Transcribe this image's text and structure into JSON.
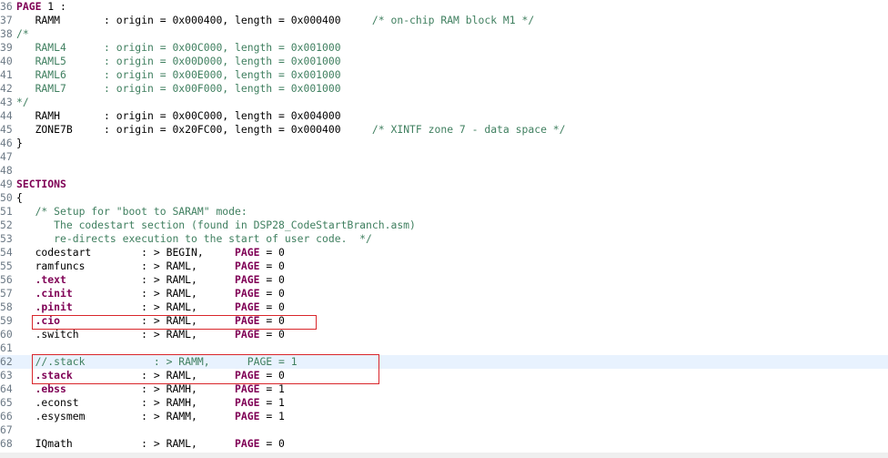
{
  "editor": {
    "lines": [
      {
        "n": "36",
        "tokens": [
          {
            "c": "kw",
            "t": "PAGE"
          },
          {
            "c": "text",
            "t": " 1 :"
          }
        ]
      },
      {
        "n": "37",
        "tokens": [
          {
            "c": "text",
            "t": "   RAMM       : origin = 0x000400, length = 0x000400     "
          },
          {
            "c": "comment",
            "t": "/* on-chip RAM block M1 */"
          }
        ]
      },
      {
        "n": "38",
        "tokens": [
          {
            "c": "comment",
            "t": "/*"
          }
        ]
      },
      {
        "n": "39",
        "tokens": [
          {
            "c": "comment",
            "t": "   RAML4      : origin = 0x00C000, length = 0x001000"
          }
        ]
      },
      {
        "n": "40",
        "tokens": [
          {
            "c": "comment",
            "t": "   RAML5      : origin = 0x00D000, length = 0x001000"
          }
        ]
      },
      {
        "n": "41",
        "tokens": [
          {
            "c": "comment",
            "t": "   RAML6      : origin = 0x00E000, length = 0x001000"
          }
        ]
      },
      {
        "n": "42",
        "tokens": [
          {
            "c": "comment",
            "t": "   RAML7      : origin = 0x00F000, length = 0x001000"
          }
        ]
      },
      {
        "n": "43",
        "tokens": [
          {
            "c": "comment",
            "t": "*/"
          }
        ]
      },
      {
        "n": "44",
        "tokens": [
          {
            "c": "text",
            "t": "   RAMH       : origin = 0x00C000, length = 0x004000"
          }
        ]
      },
      {
        "n": "45",
        "tokens": [
          {
            "c": "text",
            "t": "   ZONE7B     : origin = 0x20FC00, length = 0x000400     "
          },
          {
            "c": "comment",
            "t": "/* XINTF zone 7 - data space */"
          }
        ]
      },
      {
        "n": "46",
        "tokens": [
          {
            "c": "text",
            "t": "}"
          }
        ]
      },
      {
        "n": "47",
        "tokens": []
      },
      {
        "n": "48",
        "tokens": []
      },
      {
        "n": "49",
        "tokens": [
          {
            "c": "kw",
            "t": "SECTIONS"
          }
        ]
      },
      {
        "n": "50",
        "tokens": [
          {
            "c": "text",
            "t": "{"
          }
        ]
      },
      {
        "n": "51",
        "tokens": [
          {
            "c": "comment",
            "t": "   /* Setup for \"boot to SARAM\" mode:"
          }
        ]
      },
      {
        "n": "52",
        "tokens": [
          {
            "c": "comment",
            "t": "      The codestart section (found in DSP28_CodeStartBranch.asm)"
          }
        ]
      },
      {
        "n": "53",
        "tokens": [
          {
            "c": "comment",
            "t": "      re-directs execution to the start of user code.  */"
          }
        ]
      },
      {
        "n": "54",
        "tokens": [
          {
            "c": "text",
            "t": "   codestart        : > BEGIN,     "
          },
          {
            "c": "kw",
            "t": "PAGE"
          },
          {
            "c": "text",
            "t": " = 0"
          }
        ]
      },
      {
        "n": "55",
        "tokens": [
          {
            "c": "text",
            "t": "   ramfuncs         : > RAML,      "
          },
          {
            "c": "kw",
            "t": "PAGE"
          },
          {
            "c": "text",
            "t": " = 0"
          }
        ]
      },
      {
        "n": "56",
        "tokens": [
          {
            "c": "text",
            "t": "   "
          },
          {
            "c": "dir",
            "t": ".text"
          },
          {
            "c": "text",
            "t": "            : > RAML,      "
          },
          {
            "c": "kw",
            "t": "PAGE"
          },
          {
            "c": "text",
            "t": " = 0"
          }
        ]
      },
      {
        "n": "57",
        "tokens": [
          {
            "c": "text",
            "t": "   "
          },
          {
            "c": "dir",
            "t": ".cinit"
          },
          {
            "c": "text",
            "t": "           : > RAML,      "
          },
          {
            "c": "kw",
            "t": "PAGE"
          },
          {
            "c": "text",
            "t": " = 0"
          }
        ]
      },
      {
        "n": "58",
        "tokens": [
          {
            "c": "text",
            "t": "   "
          },
          {
            "c": "dir",
            "t": ".pinit"
          },
          {
            "c": "text",
            "t": "           : > RAML,      "
          },
          {
            "c": "kw",
            "t": "PAGE"
          },
          {
            "c": "text",
            "t": " = 0"
          }
        ]
      },
      {
        "n": "59",
        "tokens": [
          {
            "c": "text",
            "t": "   "
          },
          {
            "c": "dir",
            "t": ".cio"
          },
          {
            "c": "text",
            "t": "             : > RAML,      "
          },
          {
            "c": "kw",
            "t": "PAGE"
          },
          {
            "c": "text",
            "t": " = 0"
          }
        ]
      },
      {
        "n": "60",
        "tokens": [
          {
            "c": "text",
            "t": "   .switch          : > RAML,      "
          },
          {
            "c": "kw",
            "t": "PAGE"
          },
          {
            "c": "text",
            "t": " = 0"
          }
        ]
      },
      {
        "n": "61",
        "tokens": []
      },
      {
        "n": "62",
        "hl": true,
        "tokens": [
          {
            "c": "comment",
            "t": "   //.stack           : > RAMM,      PAGE = 1"
          }
        ]
      },
      {
        "n": "63",
        "tokens": [
          {
            "c": "text",
            "t": "   "
          },
          {
            "c": "dir",
            "t": ".stack"
          },
          {
            "c": "text",
            "t": "           : > RAML,      "
          },
          {
            "c": "kw",
            "t": "PAGE"
          },
          {
            "c": "text",
            "t": " = 0"
          }
        ]
      },
      {
        "n": "64",
        "tokens": [
          {
            "c": "text",
            "t": "   "
          },
          {
            "c": "dir",
            "t": ".ebss"
          },
          {
            "c": "text",
            "t": "            : > RAMH,      "
          },
          {
            "c": "kw",
            "t": "PAGE"
          },
          {
            "c": "text",
            "t": " = 1"
          }
        ]
      },
      {
        "n": "65",
        "tokens": [
          {
            "c": "text",
            "t": "   .econst          : > RAMH,      "
          },
          {
            "c": "kw",
            "t": "PAGE"
          },
          {
            "c": "text",
            "t": " = 1"
          }
        ]
      },
      {
        "n": "66",
        "tokens": [
          {
            "c": "text",
            "t": "   .esysmem         : > RAMM,      "
          },
          {
            "c": "kw",
            "t": "PAGE"
          },
          {
            "c": "text",
            "t": " = 1"
          }
        ]
      },
      {
        "n": "67",
        "tokens": []
      },
      {
        "n": "68",
        "tokens": [
          {
            "c": "text",
            "t": "   IQmath           : > RAML,      "
          },
          {
            "c": "kw",
            "t": "PAGE"
          },
          {
            "c": "text",
            "t": " = 0"
          }
        ]
      }
    ]
  },
  "colors": {
    "keyword": "#7f0055",
    "comment": "#3f7f5f",
    "line_number": "#6d7a86",
    "current_line": "#e8f2fe",
    "annotation_box": "#d9262b"
  }
}
